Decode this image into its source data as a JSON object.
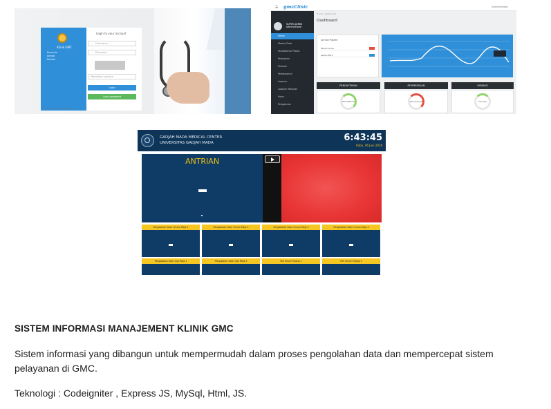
{
  "login_screenshot": {
    "brand": "Klinik GMC",
    "menu": [
      "Beranda",
      "Jadwal",
      "Kontak"
    ],
    "heading": "Login to your account",
    "username_placeholder": "Username",
    "password_placeholder": "Password",
    "captcha_placeholder": "Masukkan captcha",
    "login_button": "Login",
    "secondary_button": "Lupa password",
    "footer": "© GMC 2017. All rights reserved."
  },
  "dashboard_screenshot": {
    "logo": "gmcClinic",
    "user_top": "Administrator",
    "profile_name": "SUPER ADMIN",
    "profile_role": "Administrator",
    "sidebar": [
      "Home",
      "Master Data",
      "Pendaftaran Pasien",
      "Pelayanan",
      "Farmasi",
      "Pembayaran",
      "Laporan",
      "Laporan Tahunan",
      "Users",
      "Pengaturan"
    ],
    "breadcrumb": "Home / Dashboard",
    "title": "Dashboard",
    "card_title": "Jumlah Pasien",
    "rows": [
      "Pasien Lama",
      "Pasien Baru"
    ],
    "bars": [
      "PENDAFTARAN",
      "PEMERIKSAAN",
      "FARMASI"
    ],
    "gauges": [
      "Pendaftaran",
      "Pemeriksaan",
      "Farmasi"
    ]
  },
  "queue_screenshot": {
    "org_line1": "GADJAH MADA MEDICAL CENTER",
    "org_line2": "UNIVERSITAS GADJAH MADA",
    "clock": "6:43:45",
    "date": "Rabu, 06 Juni 2018",
    "main_title": "ANTRIAN",
    "counters": [
      "Pengobatan Kasir Umum Meja 1",
      "Pengobatan Kasir Umum Meja 2",
      "Pengobatan Kasir Umum Meja 3",
      "Pengobatan Kasir Umum Meja 4",
      "Pengobatan Kasir Gigi Meja 1",
      "Pengobatan Kasir Gigi Meja 2",
      "Poli Umum Ruang 1",
      "Poli Umum Ruang 2"
    ]
  },
  "text": {
    "title": "SISTEM INFORMASI MANAJEMENT KLINIK GMC",
    "description": "Sistem informasi yang dibangun untuk mempermudah dalam proses pengolahan data dan mempercepat sistem pelayanan di GMC.",
    "technology": "Teknologi : Codeigniter , Express JS, MySql, Html, JS."
  }
}
